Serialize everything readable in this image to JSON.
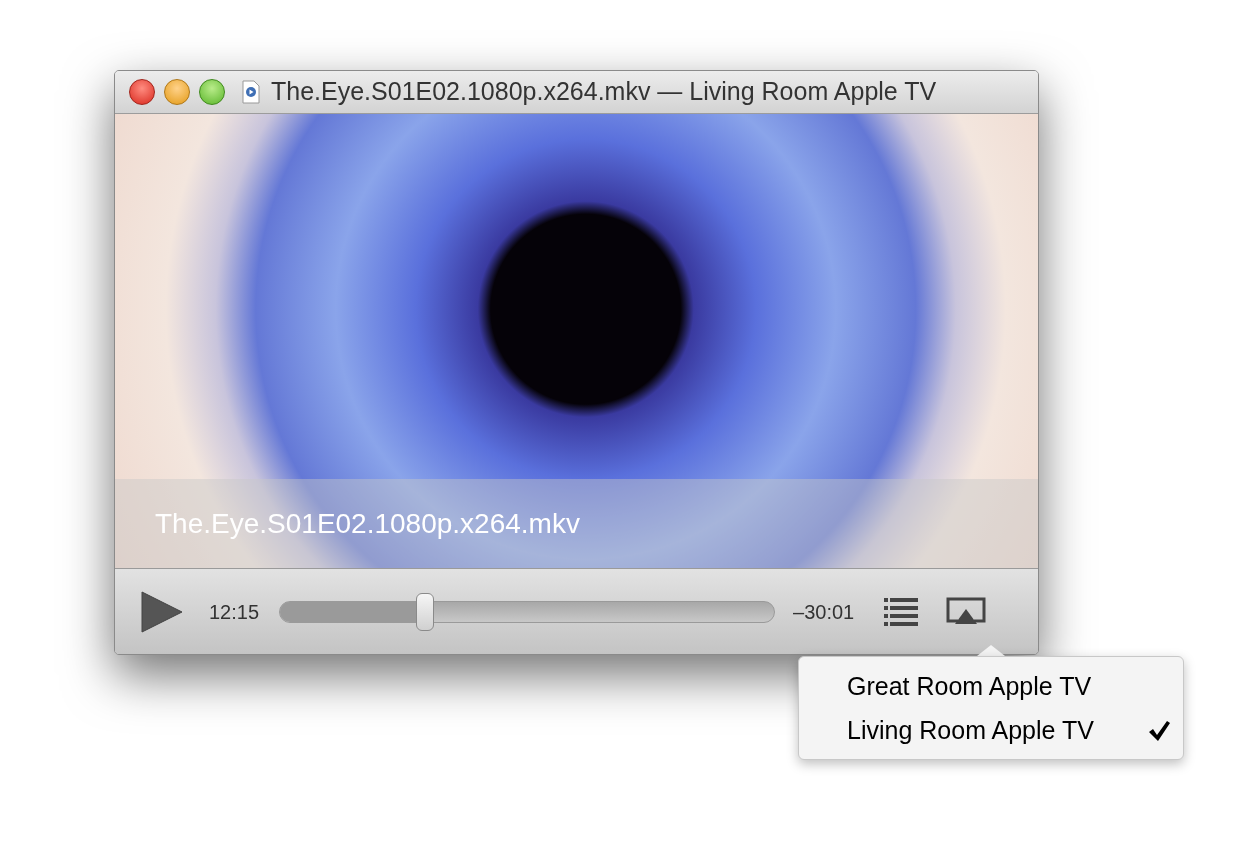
{
  "window": {
    "title": "The.Eye.S01E02.1080p.x264.mkv — Living Room Apple TV"
  },
  "video": {
    "caption": "The.Eye.S01E02.1080p.x264.mkv"
  },
  "controls": {
    "elapsed": "12:15",
    "remaining": "–30:01",
    "progress": {
      "level": 0.295
    }
  },
  "airplay_menu": {
    "items": [
      {
        "label": "Great Room Apple TV",
        "selected": false
      },
      {
        "label": "Living Room Apple TV",
        "selected": true
      }
    ]
  }
}
